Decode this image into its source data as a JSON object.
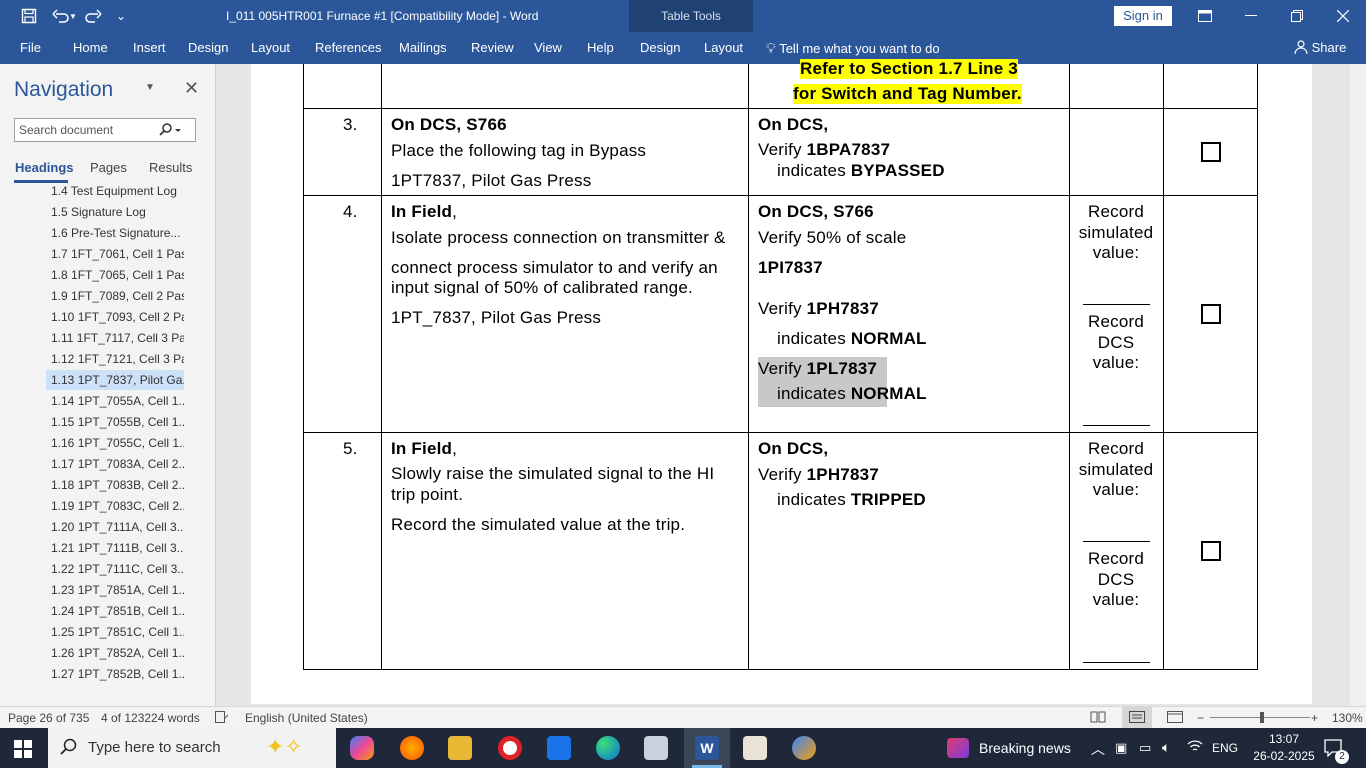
{
  "window": {
    "title": "I_011 005HTR001 Furnace #1 [Compatibility Mode] - Word",
    "table_tools": "Table Tools",
    "sign_in": "Sign in"
  },
  "ribbon": {
    "tabs": [
      "File",
      "Home",
      "Insert",
      "Design",
      "Layout",
      "References",
      "Mailings",
      "Review",
      "View",
      "Help",
      "Design",
      "Layout"
    ],
    "tell_me": "Tell me what you want to do",
    "share": "Share"
  },
  "navigation": {
    "title": "Navigation",
    "search_placeholder": "Search document",
    "tabs": [
      "Headings",
      "Pages",
      "Results"
    ],
    "items": [
      "1.4 Test Equipment Log",
      "1.5 Signature Log",
      "1.6 Pre-Test Signature...",
      "1.7 1FT_7061, Cell 1 Pas...",
      "1.8 1FT_7065, Cell 1 Pas...",
      "1.9 1FT_7089, Cell 2 Pas...",
      "1.10 1FT_7093, Cell 2 Pa...",
      "1.11 1FT_7117, Cell 3 Pa...",
      "1.12 1FT_7121, Cell 3 Pa...",
      "1.13 1PT_7837, Pilot Ga...",
      "1.14 1PT_7055A, Cell 1...",
      "1.15 1PT_7055B, Cell 1...",
      "1.16 1PT_7055C, Cell 1...",
      "1.17 1PT_7083A, Cell 2...",
      "1.18 1PT_7083B, Cell 2...",
      "1.19 1PT_7083C, Cell 2...",
      "1.20 1PT_7111A, Cell 3...",
      "1.21 1PT_7111B, Cell 3...",
      "1.22 1PT_7111C, Cell 3...",
      "1.23 1PT_7851A, Cell 1...",
      "1.24 1PT_7851B, Cell 1...",
      "1.25 1PT_7851C, Cell 1...",
      "1.26 1PT_7852A, Cell 1...",
      "1.27 1PT_7852B, Cell 1..."
    ],
    "selected_index": 9
  },
  "document": {
    "top_row": {
      "line1": "Refer to Section 1.7 Line 3",
      "line2": "for Switch and Tag Number."
    },
    "row3": {
      "num": "3.",
      "action_head": "On DCS, S766",
      "action_l1": "Place the following tag in Bypass",
      "action_l2": "1PT7837, Pilot Gas Press",
      "result_head": "On DCS,",
      "result_l1_a": "Verify ",
      "result_l1_b": "1BPA7837",
      "result_l2_a": "indicates ",
      "result_l2_b": "BYPASSED"
    },
    "row4": {
      "num": "4.",
      "action_head_a": "In Field",
      "action_head_b": ",",
      "action_l1": "Isolate process connection on transmitter &",
      "action_l2": "connect process simulator to and verify an",
      "action_l3": "input signal of 50% of calibrated range.",
      "action_l4": "1PT_7837, Pilot Gas Press",
      "result_head": "On DCS, S766",
      "result_l1": "Verify 50% of scale",
      "result_l2": "1PI7837",
      "result_l3_a": "Verify ",
      "result_l3_b": "1PH7837",
      "result_l4_a": "indicates ",
      "result_l4_b": "NORMAL",
      "result_l5_a": "Verify ",
      "result_l5_b": "1PL7837",
      "result_l6_a": "indicates ",
      "result_l6_b": "NORMAL",
      "rec1": [
        "Record",
        "simulated",
        "value:"
      ],
      "rec2": [
        "Record",
        "DCS",
        "value:"
      ]
    },
    "row5": {
      "num": "5.",
      "action_head_a": "In Field",
      "action_head_b": ",",
      "action_l1": "Slowly raise the simulated signal to the HI",
      "action_l2": "trip point.",
      "action_l3": "Record the simulated value at the trip.",
      "result_head": "On DCS,",
      "result_l1_a": "Verify ",
      "result_l1_b": "1PH7837",
      "result_l2_a": "indicates ",
      "result_l2_b": "TRIPPED",
      "rec1": [
        "Record",
        "simulated",
        "value:"
      ],
      "rec2": [
        "Record",
        "DCS",
        "value:"
      ]
    }
  },
  "status": {
    "page": "Page 26 of 735",
    "words": "4 of 123224 words",
    "language": "English (United States)",
    "zoom": "130%"
  },
  "taskbar": {
    "search_placeholder": "Type here to search",
    "news": "Breaking news",
    "lang": "ENG",
    "time": "13:07",
    "date": "26-02-2025",
    "notif_count": "2"
  }
}
